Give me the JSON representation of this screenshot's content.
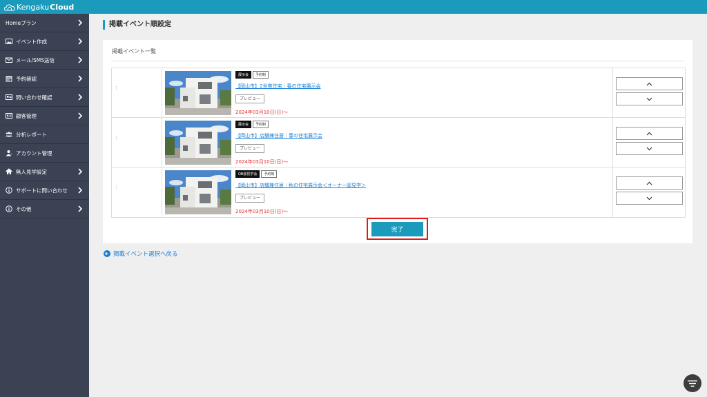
{
  "app": {
    "logo_part1": "Kengaku",
    "logo_part2": "Cloud"
  },
  "sidebar": {
    "items": [
      {
        "label": "Homeプラン",
        "icon": "none",
        "has_chevron": true
      },
      {
        "label": "イベント作成",
        "icon": "image-icon",
        "has_chevron": true
      },
      {
        "label": "メール/SMS送信",
        "icon": "mail-icon",
        "has_chevron": true
      },
      {
        "label": "予約確認",
        "icon": "calendar-icon",
        "has_chevron": true
      },
      {
        "label": "問い合わせ確認",
        "icon": "inquiry-icon",
        "has_chevron": true
      },
      {
        "label": "顧客管理",
        "icon": "id-card-icon",
        "has_chevron": true
      },
      {
        "label": "分析レポート",
        "icon": "users-icon",
        "has_chevron": false
      },
      {
        "label": "アカウント管理",
        "icon": "user-icon",
        "has_chevron": false
      },
      {
        "label": "無人見学設定",
        "icon": "home-icon",
        "has_chevron": true
      },
      {
        "label": "サポートに問い合わせ",
        "icon": "info-icon",
        "has_chevron": true
      },
      {
        "label": "その他",
        "icon": "info-icon",
        "has_chevron": true
      }
    ]
  },
  "page": {
    "title": "掲載イベント順設定",
    "panel_title": "掲載イベント一覧",
    "done_label": "完了",
    "back_label": "掲載イベント選択へ戻る"
  },
  "events": [
    {
      "badge1": "展示会",
      "badge2": "予約制",
      "title": "【岡山市】2世帯住宅｜春の住宅展示会",
      "preview": "プレビュー",
      "date": "2024年03月10日(日)〜"
    },
    {
      "badge1": "展示会",
      "badge2": "予約制",
      "title": "【岡山市】店舗兼住居｜春の住宅展示会",
      "preview": "プレビュー",
      "date": "2024年03月10日(日)〜"
    },
    {
      "badge1": "OB邸見学会",
      "badge2": "予約制",
      "title": "【岡山市】店舗兼住居｜秋の住宅展示会＜オーナー邸見学＞",
      "preview": "プレビュー",
      "date": "2024年03月10日(日)〜"
    }
  ],
  "colors": {
    "accent": "#1a9bbb",
    "sidebar": "#3a4254",
    "link": "#1a7fd4",
    "date": "#e03030",
    "highlight": "#e01a1a"
  }
}
